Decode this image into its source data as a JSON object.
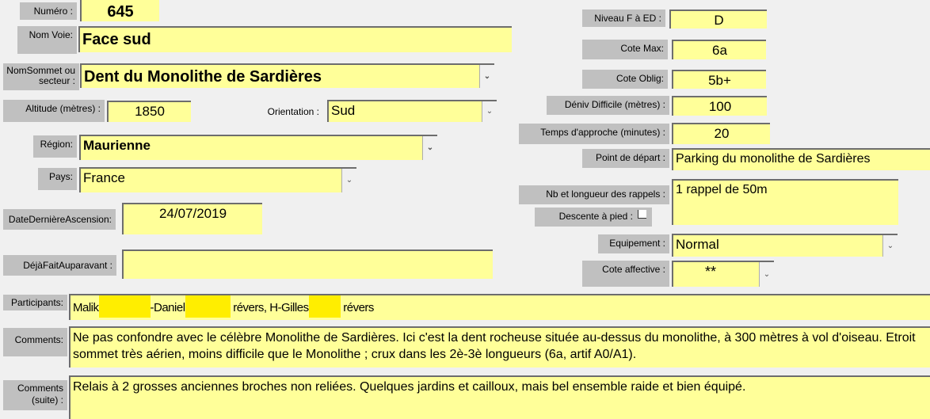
{
  "fields": {
    "numero": {
      "label": "Numéro :",
      "value": "645"
    },
    "nom_voie": {
      "label": "Nom Voie:",
      "value": "Face sud"
    },
    "nom_sommet": {
      "label": "NomSommet ou secteur :",
      "value": "Dent du Monolithe de Sardières"
    },
    "altitude": {
      "label": "Altitude (mètres) :",
      "value": "1850"
    },
    "orientation": {
      "label": "Orientation :",
      "value": "Sud"
    },
    "region": {
      "label": "Région:",
      "value": "Maurienne"
    },
    "pays": {
      "label": "Pays:",
      "value": "France"
    },
    "date_derniere": {
      "label": "DateDernièreAscension:",
      "value": "24/07/2019"
    },
    "deja_fait": {
      "label": "DéjàFaitAuparavant :",
      "value": ""
    },
    "participants": {
      "label": "Participants:",
      "parts": [
        "Malik",
        "-Daniel",
        "révers, H-Gilles",
        "révers"
      ]
    },
    "comments": {
      "label": "Comments:",
      "value": "Ne pas confondre avec le célèbre Monolithe de Sardières. Ici c'est la dent rocheuse située au-dessus du monolithe, à 300 mètres à vol d'oiseau. Etroit sommet très aérien, moins difficile que le Monolithe ; crux dans les 2è-3è longueurs (6a, artif A0/A1)."
    },
    "comments_suite": {
      "label": "Comments (suite) :",
      "value": "Relais à 2 grosses anciennes broches non reliées. Quelques jardins et cailloux, mais bel ensemble raide et bien équipé."
    },
    "niveau": {
      "label": "Niveau F à ED :",
      "value": "D"
    },
    "cote_max": {
      "label": "Cote Max:",
      "value": "6a"
    },
    "cote_oblig": {
      "label": "Cote Oblig:",
      "value": "5b+"
    },
    "deniv": {
      "label": "Déniv Difficile (mètres) :",
      "value": "100"
    },
    "temps_approche": {
      "label": "Temps d'approche (minutes) :",
      "value": "20"
    },
    "point_depart": {
      "label": "Point de départ :",
      "value": "Parking du monolithe de Sardières"
    },
    "rappels": {
      "label": "Nb et longueur des rappels :",
      "value": "1 rappel de 50m"
    },
    "descente_pied": {
      "label": "Descente à pied :",
      "checked": false
    },
    "equipement": {
      "label": "Equipement :",
      "value": "Normal"
    },
    "cote_affective": {
      "label": "Cote affective :",
      "value": "**"
    }
  },
  "colors": {
    "field": "#ffff99",
    "label": "#c0c0c0",
    "background": "#f0f0f0",
    "redaction": "#ffee00"
  },
  "icons": {
    "dropdown": "chevron-down-icon"
  }
}
